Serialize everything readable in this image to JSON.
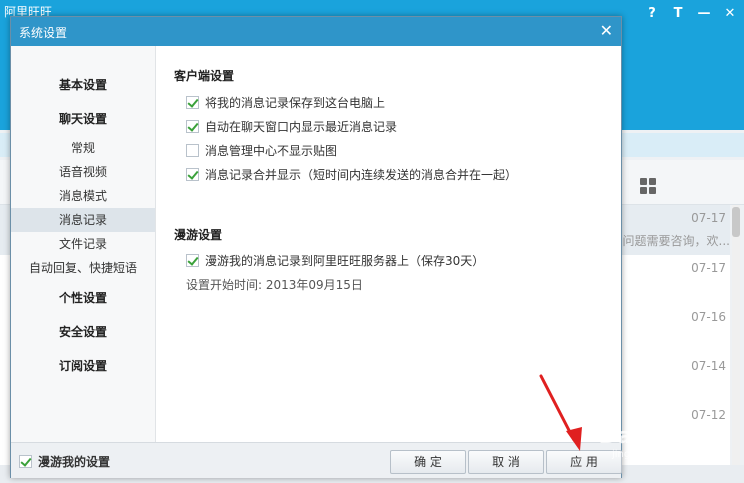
{
  "background_app": {
    "title": "阿里旺旺",
    "controls": [
      "?",
      "T",
      "—",
      "✕"
    ],
    "rows": [
      {
        "date": "07-17",
        "snippet": "有问题需要咨询，欢..."
      },
      {
        "date": "07-17",
        "snippet": ""
      },
      {
        "date": "07-16",
        "snippet": ""
      },
      {
        "date": "07-14",
        "snippet": ""
      },
      {
        "date": "07-12",
        "snippet": ""
      }
    ]
  },
  "dialog": {
    "title": "系统设置",
    "close_glyph": "✕",
    "nav": [
      {
        "label": "基本设置",
        "kind": "group"
      },
      {
        "label": "聊天设置",
        "kind": "group"
      },
      {
        "label": "常规",
        "kind": "sub"
      },
      {
        "label": "语音视频",
        "kind": "sub"
      },
      {
        "label": "消息模式",
        "kind": "sub"
      },
      {
        "label": "消息记录",
        "kind": "sub",
        "active": true
      },
      {
        "label": "文件记录",
        "kind": "sub"
      },
      {
        "label": "自动回复、快捷短语",
        "kind": "sub"
      },
      {
        "label": "个性设置",
        "kind": "group"
      },
      {
        "label": "安全设置",
        "kind": "group"
      },
      {
        "label": "订阅设置",
        "kind": "group"
      }
    ],
    "client_section": {
      "title": "客户端设置",
      "options": [
        {
          "label": "将我的消息记录保存到这台电脑上",
          "checked": true
        },
        {
          "label": "自动在聊天窗口内显示最近消息记录",
          "checked": true
        },
        {
          "label": "消息管理中心不显示贴图",
          "checked": false
        },
        {
          "label": "消息记录合并显示（短时间内连续发送的消息合并在一起）",
          "checked": true
        }
      ]
    },
    "roaming_section": {
      "title": "漫游设置",
      "option": {
        "label": "漫游我的消息记录到阿里旺旺服务器上（保存30天）",
        "checked": true
      },
      "since": "设置开始时间: 2013年09月15日"
    },
    "footer": {
      "roam_my_settings": {
        "label": "漫游我的设置",
        "checked": true
      },
      "ok": "确 定",
      "cancel": "取 消",
      "apply": "应 用"
    }
  },
  "watermark": {
    "text": "Baidu经验",
    "sub": "jingyan.baidu.com"
  },
  "colors": {
    "accent": "#2f95c9",
    "check": "#3aa13a",
    "arrow": "#e02020"
  }
}
